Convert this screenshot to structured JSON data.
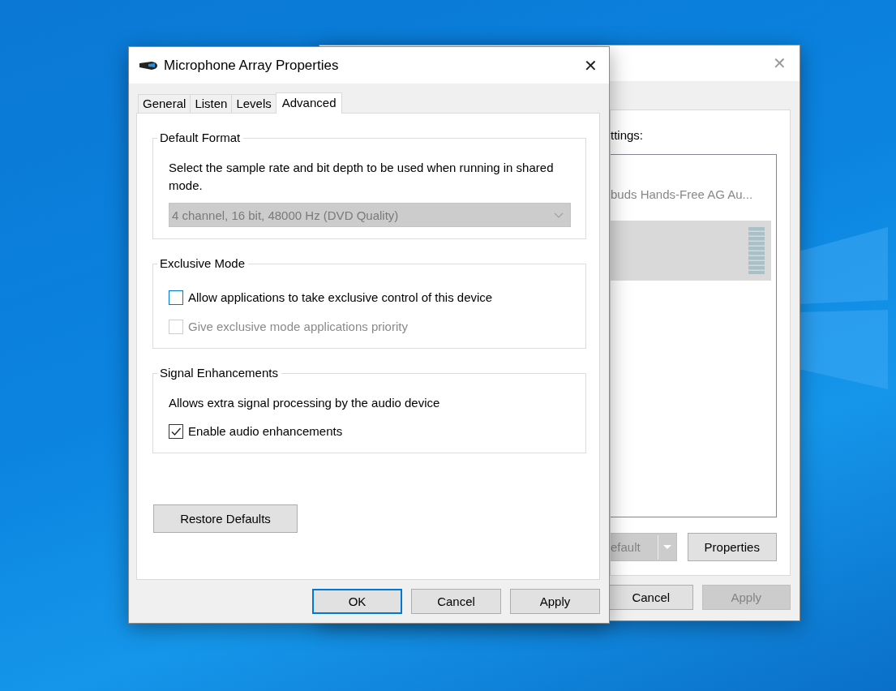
{
  "back_window": {
    "close": "✕",
    "header_text": "ttings:",
    "devices": [
      {
        "name": "buds Hands-Free AG Au...",
        "selected": false
      },
      {
        "selected": true
      }
    ],
    "buttons": [
      {
        "kind": "split",
        "label": "efault",
        "disabled": true
      },
      {
        "kind": "plain",
        "label": "Properties",
        "disabled": false
      }
    ],
    "dialog_buttons": [
      {
        "label": "Cancel",
        "disabled": false
      },
      {
        "label": "Apply",
        "disabled": true
      }
    ]
  },
  "window": {
    "title": "Microphone Array Properties",
    "close": "✕"
  },
  "tabs": [
    {
      "label": "General",
      "selected": false
    },
    {
      "label": "Listen",
      "selected": false
    },
    {
      "label": "Levels",
      "selected": false
    },
    {
      "label": "Advanced",
      "selected": true
    }
  ],
  "default_format": {
    "title": "Default Format",
    "description": "Select the sample rate and bit depth to be used when running in shared mode.",
    "format_select": {
      "value": "4 channel, 16 bit, 48000 Hz (DVD Quality)",
      "disabled": true
    }
  },
  "exclusive_mode": {
    "title": "Exclusive Mode",
    "options": [
      {
        "label": "Allow applications to take exclusive control of this device",
        "checked": false,
        "disabled": false,
        "focused": true
      },
      {
        "label": "Give exclusive mode applications priority",
        "checked": false,
        "disabled": true,
        "focused": false
      }
    ]
  },
  "signal_enhancements": {
    "title": "Signal Enhancements",
    "description": "Allows extra signal processing by the audio device",
    "options": [
      {
        "label": "Enable audio enhancements",
        "checked": true,
        "disabled": false,
        "focused": false
      }
    ]
  },
  "restore_defaults": "Restore Defaults",
  "buttons": [
    {
      "label": "OK",
      "default": true,
      "disabled": false
    },
    {
      "label": "Cancel",
      "default": false,
      "disabled": false
    },
    {
      "label": "Apply",
      "default": false,
      "disabled": false
    }
  ]
}
